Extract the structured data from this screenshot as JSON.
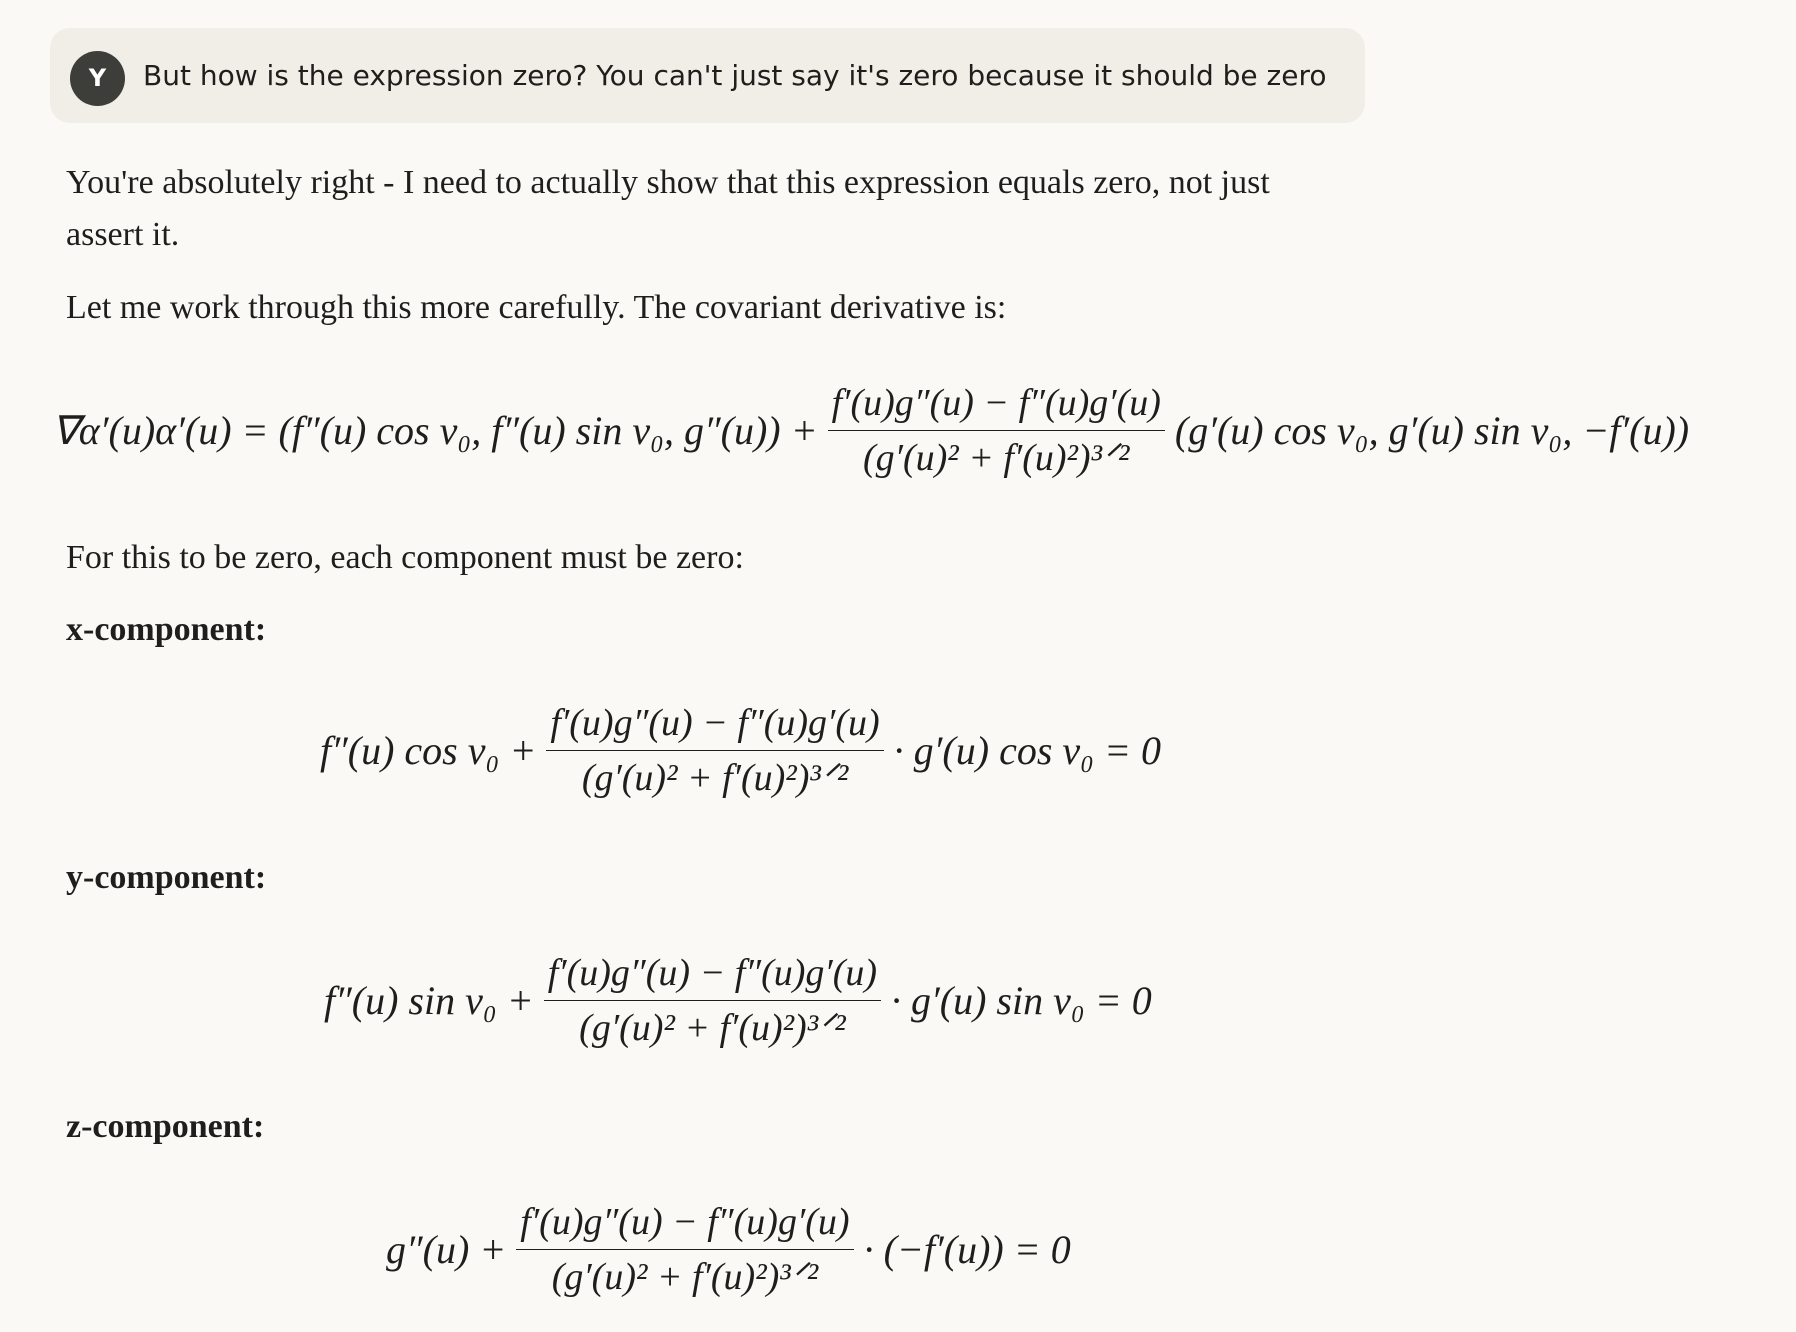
{
  "user_message": {
    "avatar_letter": "Y",
    "text": "But how is the expression zero? You can't just say it's zero because it should be zero"
  },
  "response": {
    "para1_line1": "You're absolutely right - I need to actually show that this expression equals zero, not just",
    "para1_line2": "assert it.",
    "para2": "Let me work through this more carefully. The covariant derivative is:",
    "para3": "For this to be zero, each component must be zero:",
    "x_heading": "x-component:",
    "y_heading": "y-component:",
    "z_heading": "z-component:"
  },
  "equations": {
    "main": {
      "left": "∇α′(u)α′(u) = (f″(u) cos v₀, f″(u) sin v₀, g″(u)) +",
      "num": "f′(u)g″(u) − f″(u)g′(u)",
      "den": "(g′(u)² + f′(u)²)³ᐟ²",
      "right": "(g′(u) cos v₀, g′(u) sin v₀, −f′(u))"
    },
    "x": {
      "left": "f″(u) cos v₀ +",
      "num": "f′(u)g″(u) − f″(u)g′(u)",
      "den": "(g′(u)² + f′(u)²)³ᐟ²",
      "right": "· g′(u) cos v₀ = 0"
    },
    "y": {
      "left": "f″(u) sin v₀ +",
      "num": "f′(u)g″(u) − f″(u)g′(u)",
      "den": "(g′(u)² + f′(u)²)³ᐟ²",
      "right": "· g′(u) sin v₀ = 0"
    },
    "z": {
      "left": "g″(u) +",
      "num": "f′(u)g″(u) − f″(u)g′(u)",
      "den": "(g′(u)² + f′(u)²)³ᐟ²",
      "right": "· (−f′(u)) = 0"
    }
  }
}
